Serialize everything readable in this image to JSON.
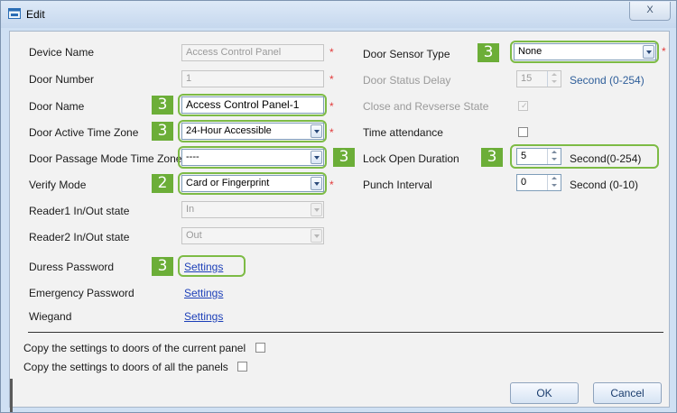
{
  "window": {
    "title": "Edit",
    "close_glyph": "X"
  },
  "left": {
    "device_name": {
      "label": "Device Name",
      "value": "Access Control Panel",
      "required": "*"
    },
    "door_number": {
      "label": "Door Number",
      "value": "1",
      "required": "*"
    },
    "door_name": {
      "label": "Door Name",
      "value": "Access Control Panel-1",
      "required": "*",
      "badge": "3"
    },
    "door_active_tz": {
      "label": "Door Active Time Zone",
      "value": "24-Hour Accessible",
      "required": "*",
      "badge": "3"
    },
    "passage_mode_tz": {
      "label": "Door Passage Mode Time Zone",
      "value": "----",
      "badge": "3"
    },
    "verify_mode": {
      "label": "Verify Mode",
      "value": "Card or Fingerprint",
      "required": "*",
      "badge": "2"
    },
    "reader1": {
      "label": "Reader1 In/Out state",
      "value": "In"
    },
    "reader2": {
      "label": "Reader2 In/Out state",
      "value": "Out"
    },
    "duress": {
      "label": "Duress Password",
      "link": "Settings",
      "badge": "3"
    },
    "emergency": {
      "label": "Emergency Password",
      "link": "Settings"
    },
    "wiegand": {
      "label": "Wiegand",
      "link": "Settings"
    }
  },
  "right": {
    "sensor_type": {
      "label": "Door Sensor Type",
      "value": "None",
      "required": "*",
      "badge": "3"
    },
    "status_delay": {
      "label": "Door Status Delay",
      "value": "15",
      "unit": "Second (0-254)"
    },
    "close_reverse": {
      "label": "Close and Revserse State",
      "checked": true
    },
    "time_attendance": {
      "label": "Time attendance",
      "checked": false
    },
    "lock_open": {
      "label": "Lock Open Duration",
      "value": "5",
      "unit": "Second(0-254)",
      "badge": "3"
    },
    "punch_interval": {
      "label": "Punch Interval",
      "value": "0",
      "unit": "Second (0-10)"
    }
  },
  "copy": {
    "current_panel": "Copy the settings to doors of the current panel",
    "all_panels": "Copy the settings to doors of all the panels"
  },
  "buttons": {
    "ok": "OK",
    "cancel": "Cancel"
  },
  "colors": {
    "highlight": "#7dbb45",
    "badge": "#6cae38",
    "required": "#e23a3a",
    "link": "#1c3fb8"
  }
}
